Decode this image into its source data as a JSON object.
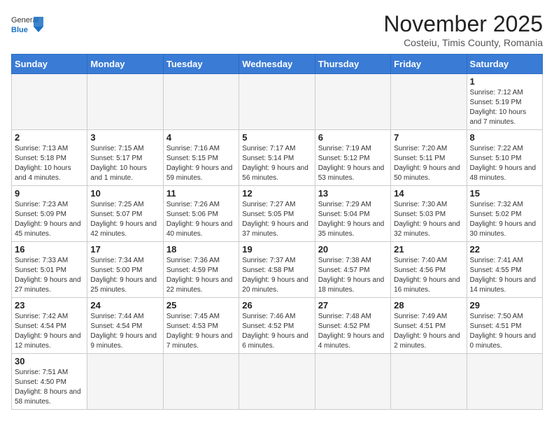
{
  "header": {
    "logo_general": "General",
    "logo_blue": "Blue",
    "month_year": "November 2025",
    "location": "Costeiu, Timis County, Romania"
  },
  "days_of_week": [
    "Sunday",
    "Monday",
    "Tuesday",
    "Wednesday",
    "Thursday",
    "Friday",
    "Saturday"
  ],
  "weeks": [
    [
      {
        "day": "",
        "info": ""
      },
      {
        "day": "",
        "info": ""
      },
      {
        "day": "",
        "info": ""
      },
      {
        "day": "",
        "info": ""
      },
      {
        "day": "",
        "info": ""
      },
      {
        "day": "",
        "info": ""
      },
      {
        "day": "1",
        "info": "Sunrise: 7:12 AM\nSunset: 5:19 PM\nDaylight: 10 hours and 7 minutes."
      }
    ],
    [
      {
        "day": "2",
        "info": "Sunrise: 7:13 AM\nSunset: 5:18 PM\nDaylight: 10 hours and 4 minutes."
      },
      {
        "day": "3",
        "info": "Sunrise: 7:15 AM\nSunset: 5:17 PM\nDaylight: 10 hours and 1 minute."
      },
      {
        "day": "4",
        "info": "Sunrise: 7:16 AM\nSunset: 5:15 PM\nDaylight: 9 hours and 59 minutes."
      },
      {
        "day": "5",
        "info": "Sunrise: 7:17 AM\nSunset: 5:14 PM\nDaylight: 9 hours and 56 minutes."
      },
      {
        "day": "6",
        "info": "Sunrise: 7:19 AM\nSunset: 5:12 PM\nDaylight: 9 hours and 53 minutes."
      },
      {
        "day": "7",
        "info": "Sunrise: 7:20 AM\nSunset: 5:11 PM\nDaylight: 9 hours and 50 minutes."
      },
      {
        "day": "8",
        "info": "Sunrise: 7:22 AM\nSunset: 5:10 PM\nDaylight: 9 hours and 48 minutes."
      }
    ],
    [
      {
        "day": "9",
        "info": "Sunrise: 7:23 AM\nSunset: 5:09 PM\nDaylight: 9 hours and 45 minutes."
      },
      {
        "day": "10",
        "info": "Sunrise: 7:25 AM\nSunset: 5:07 PM\nDaylight: 9 hours and 42 minutes."
      },
      {
        "day": "11",
        "info": "Sunrise: 7:26 AM\nSunset: 5:06 PM\nDaylight: 9 hours and 40 minutes."
      },
      {
        "day": "12",
        "info": "Sunrise: 7:27 AM\nSunset: 5:05 PM\nDaylight: 9 hours and 37 minutes."
      },
      {
        "day": "13",
        "info": "Sunrise: 7:29 AM\nSunset: 5:04 PM\nDaylight: 9 hours and 35 minutes."
      },
      {
        "day": "14",
        "info": "Sunrise: 7:30 AM\nSunset: 5:03 PM\nDaylight: 9 hours and 32 minutes."
      },
      {
        "day": "15",
        "info": "Sunrise: 7:32 AM\nSunset: 5:02 PM\nDaylight: 9 hours and 30 minutes."
      }
    ],
    [
      {
        "day": "16",
        "info": "Sunrise: 7:33 AM\nSunset: 5:01 PM\nDaylight: 9 hours and 27 minutes."
      },
      {
        "day": "17",
        "info": "Sunrise: 7:34 AM\nSunset: 5:00 PM\nDaylight: 9 hours and 25 minutes."
      },
      {
        "day": "18",
        "info": "Sunrise: 7:36 AM\nSunset: 4:59 PM\nDaylight: 9 hours and 22 minutes."
      },
      {
        "day": "19",
        "info": "Sunrise: 7:37 AM\nSunset: 4:58 PM\nDaylight: 9 hours and 20 minutes."
      },
      {
        "day": "20",
        "info": "Sunrise: 7:38 AM\nSunset: 4:57 PM\nDaylight: 9 hours and 18 minutes."
      },
      {
        "day": "21",
        "info": "Sunrise: 7:40 AM\nSunset: 4:56 PM\nDaylight: 9 hours and 16 minutes."
      },
      {
        "day": "22",
        "info": "Sunrise: 7:41 AM\nSunset: 4:55 PM\nDaylight: 9 hours and 14 minutes."
      }
    ],
    [
      {
        "day": "23",
        "info": "Sunrise: 7:42 AM\nSunset: 4:54 PM\nDaylight: 9 hours and 12 minutes."
      },
      {
        "day": "24",
        "info": "Sunrise: 7:44 AM\nSunset: 4:54 PM\nDaylight: 9 hours and 9 minutes."
      },
      {
        "day": "25",
        "info": "Sunrise: 7:45 AM\nSunset: 4:53 PM\nDaylight: 9 hours and 7 minutes."
      },
      {
        "day": "26",
        "info": "Sunrise: 7:46 AM\nSunset: 4:52 PM\nDaylight: 9 hours and 6 minutes."
      },
      {
        "day": "27",
        "info": "Sunrise: 7:48 AM\nSunset: 4:52 PM\nDaylight: 9 hours and 4 minutes."
      },
      {
        "day": "28",
        "info": "Sunrise: 7:49 AM\nSunset: 4:51 PM\nDaylight: 9 hours and 2 minutes."
      },
      {
        "day": "29",
        "info": "Sunrise: 7:50 AM\nSunset: 4:51 PM\nDaylight: 9 hours and 0 minutes."
      }
    ],
    [
      {
        "day": "30",
        "info": "Sunrise: 7:51 AM\nSunset: 4:50 PM\nDaylight: 8 hours and 58 minutes."
      },
      {
        "day": "",
        "info": ""
      },
      {
        "day": "",
        "info": ""
      },
      {
        "day": "",
        "info": ""
      },
      {
        "day": "",
        "info": ""
      },
      {
        "day": "",
        "info": ""
      },
      {
        "day": "",
        "info": ""
      }
    ]
  ]
}
